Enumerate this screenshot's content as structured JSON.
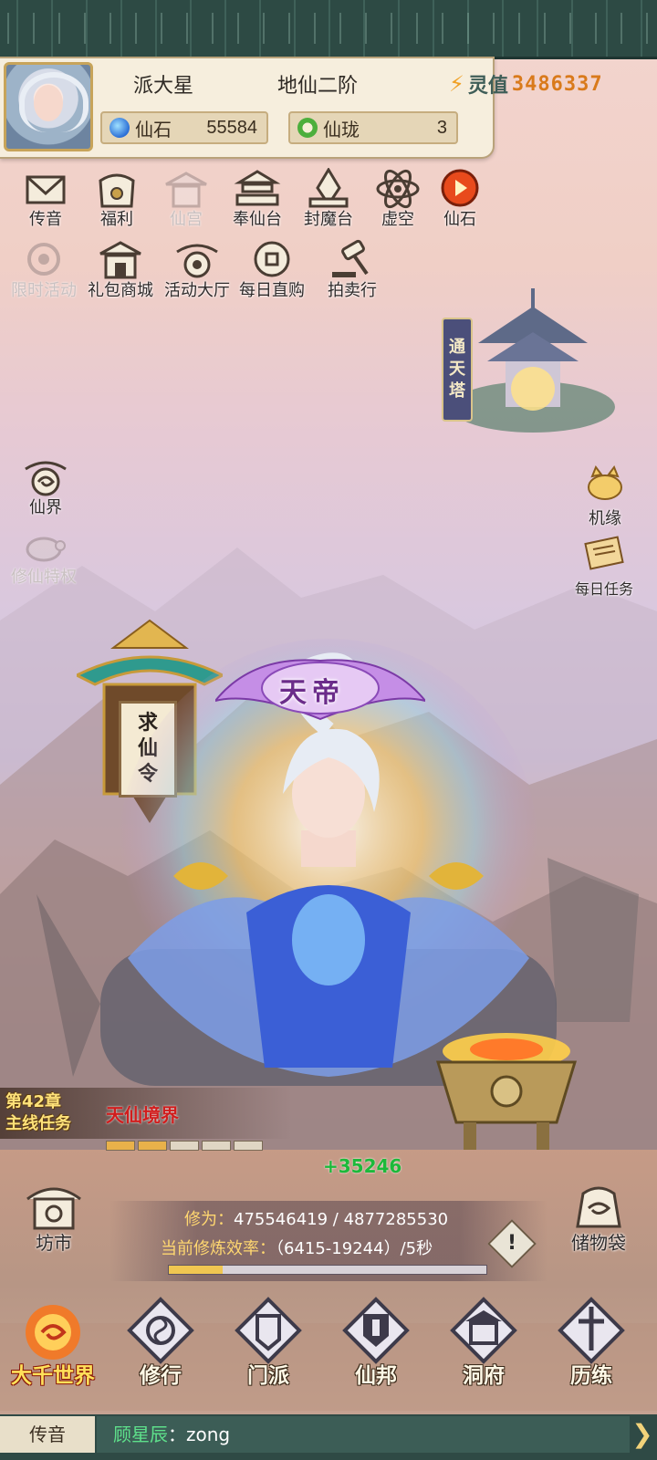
{
  "player": {
    "name": "派大星",
    "rank": "地仙二阶",
    "power_label": "灵值",
    "power_value": "3486337"
  },
  "resources": [
    {
      "label": "仙石",
      "value": "55584"
    },
    {
      "label": "仙珑",
      "value": "3"
    }
  ],
  "top_icons_row1": [
    {
      "label": "传音"
    },
    {
      "label": "福利"
    },
    {
      "label": "仙宫"
    },
    {
      "label": "奉仙台"
    },
    {
      "label": "封魔台"
    },
    {
      "label": "虚空"
    },
    {
      "label": "仙石"
    }
  ],
  "top_icons_row2": [
    {
      "label": "限时活动"
    },
    {
      "label": "礼包商城"
    },
    {
      "label": "活动大厅"
    },
    {
      "label": "每日直购"
    },
    {
      "label": "拍卖行"
    }
  ],
  "left_side": [
    {
      "label": "仙界"
    },
    {
      "label": "修仙特权"
    }
  ],
  "right_side": [
    {
      "label": "机缘"
    },
    {
      "label": "每日任务"
    }
  ],
  "tower_sign": [
    "通",
    "天",
    "塔"
  ],
  "lantern_text": [
    "求",
    "仙",
    "令"
  ],
  "title_badge": "天帝",
  "mission": {
    "chapter": "第42章",
    "type": "主线任务",
    "realm": "天仙境界",
    "progress_segments": 5,
    "progress_filled": 2
  },
  "gain": "+35246",
  "cultivation": {
    "xiuwei_label": "修为：",
    "xiuwei_value": "475546419 / 4877285530",
    "rate_label": "当前修炼效率：",
    "rate_value": "（6415-19244）/5秒",
    "progress_fraction": 0.17
  },
  "side_buttons": {
    "market": "坊市",
    "bag": "储物袋",
    "alert": "!"
  },
  "bottom_nav": [
    {
      "label": "大千世界",
      "active": true
    },
    {
      "label": "修行"
    },
    {
      "label": "门派"
    },
    {
      "label": "仙邦"
    },
    {
      "label": "洞府"
    },
    {
      "label": "历练"
    }
  ],
  "chat": {
    "channel": "传音",
    "user": "顾星辰",
    "message": "：zong"
  },
  "colors": {
    "accent": "#d97a1b",
    "dark_teal": "#2f4a45",
    "realm_red": "#d11d1d",
    "gain_green": "#1cb93a"
  }
}
